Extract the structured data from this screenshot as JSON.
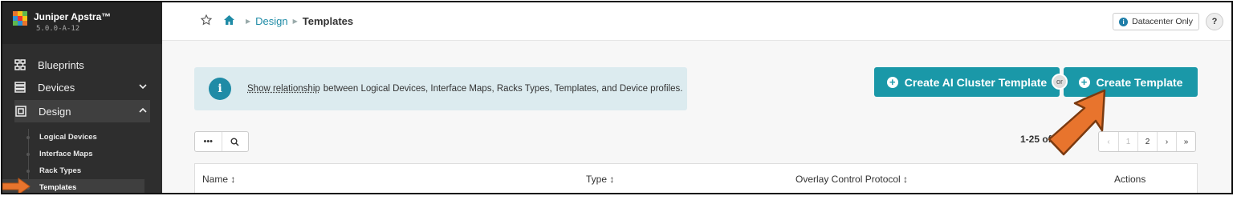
{
  "app": {
    "name": "Juniper Apstra™",
    "version": "5.0.0-A-12"
  },
  "sidebar": {
    "items": [
      {
        "label": "Blueprints",
        "icon": "blueprints-icon"
      },
      {
        "label": "Devices",
        "icon": "devices-icon"
      },
      {
        "label": "Design",
        "icon": "design-icon"
      }
    ],
    "design_subitems": [
      "Logical Devices",
      "Interface Maps",
      "Rack Types",
      "Templates"
    ]
  },
  "breadcrumb": {
    "link": "Design",
    "current": "Templates"
  },
  "header": {
    "datacenter_badge": "Datacenter Only",
    "help": "?"
  },
  "info": {
    "link_text": "Show relationship",
    "text": "between Logical Devices, Interface Maps, Racks Types, Templates, and Device profiles."
  },
  "actions": {
    "create_ai": "Create AI Cluster Template",
    "or": "or",
    "create": "Create Template"
  },
  "toolbar": {
    "more": "•••",
    "search": "search-icon"
  },
  "pagination": {
    "range": "1-25 of",
    "pages": [
      "‹",
      "1",
      "2",
      "›",
      "»"
    ]
  },
  "table": {
    "columns": [
      "Name ↕",
      "Type ↕",
      "Overlay Control Protocol ↕",
      "Actions"
    ]
  },
  "colors": {
    "accent": "#1a98a8",
    "sidebar": "#2e2e2e",
    "arrow": "#e8742d"
  }
}
